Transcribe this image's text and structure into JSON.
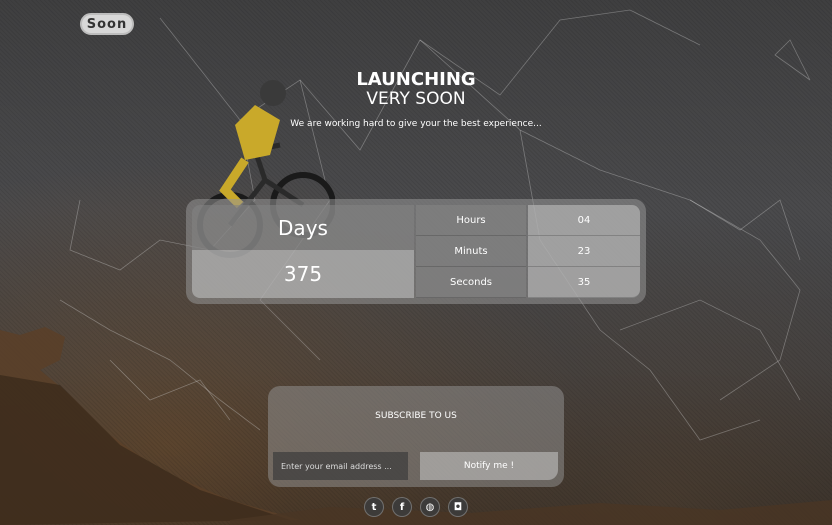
{
  "brand": {
    "logo_text": "Soon"
  },
  "hero": {
    "title_line1": "LAUNCHING",
    "title_line2": "VERY SOON",
    "tagline": "We are working hard to give your the best experience..."
  },
  "countdown": {
    "days_label": "Days",
    "days_value": "375",
    "units": [
      {
        "label": "Hours",
        "value": "04"
      },
      {
        "label": "Minuts",
        "value": "23"
      },
      {
        "label": "Seconds",
        "value": "35"
      }
    ]
  },
  "subscribe": {
    "title": "SUBSCRIBE TO US",
    "email_placeholder": "Enter your email address ...",
    "button_label": "Notify me !"
  },
  "social": [
    {
      "icon": "twitter-icon",
      "glyph": "t"
    },
    {
      "icon": "facebook-icon",
      "glyph": "f"
    },
    {
      "icon": "dribbble-icon",
      "glyph": "◍"
    },
    {
      "icon": "instagram-icon",
      "glyph": "◘"
    }
  ]
}
